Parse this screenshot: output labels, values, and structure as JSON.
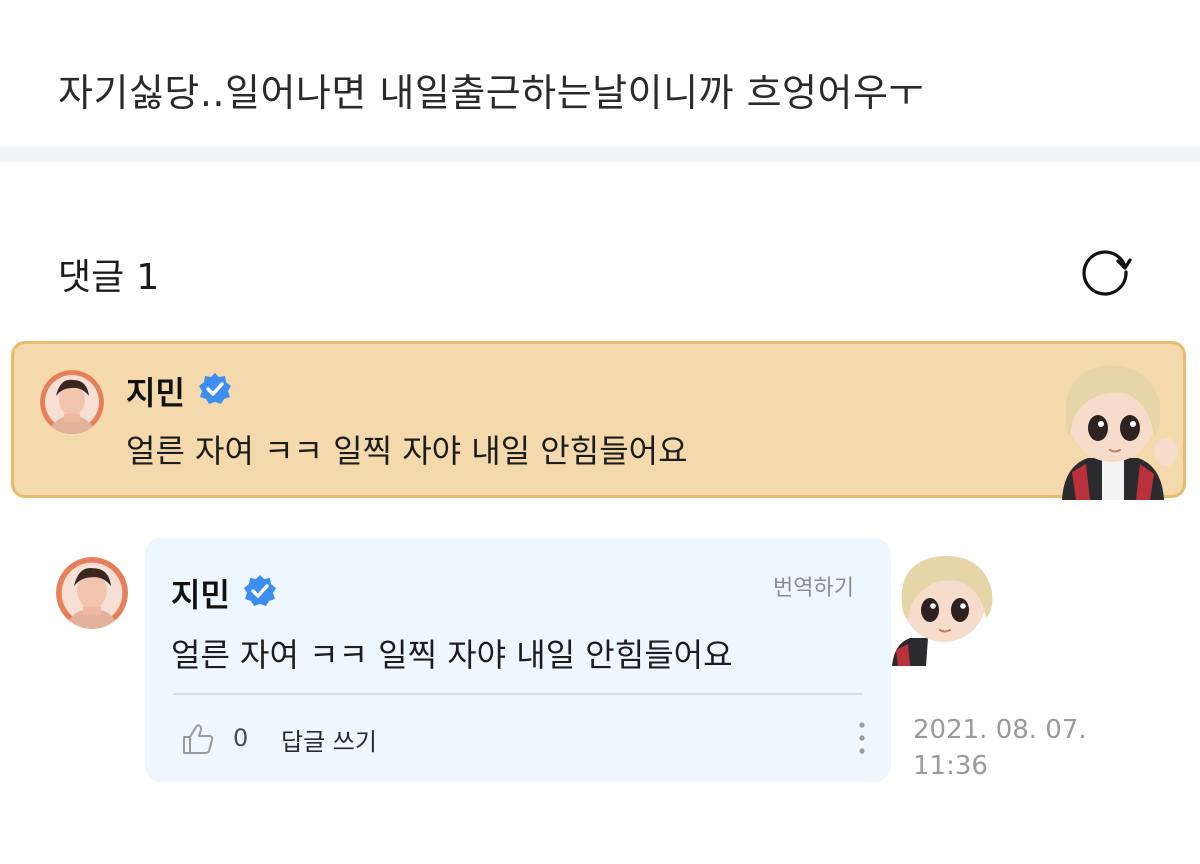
{
  "post": {
    "text": "자기싫당..일어나면 내일출근하는날이니까 흐엉어우ㅜ"
  },
  "comments_header": {
    "label": "댓글",
    "count": "1"
  },
  "icons": {
    "refresh": "refresh-icon",
    "verified": "verified-badge-icon",
    "like": "thumbs-up-icon",
    "more": "more-vertical-icon"
  },
  "colors": {
    "pinned_background": "#f4d9ac",
    "pinned_border": "#e7bd6d",
    "bubble_background": "#eef7fd",
    "verified_blue": "#3d8ef0"
  },
  "pinned_comment": {
    "author": "지민",
    "text": "얼른 자여 ㅋㅋ 일찍 자야 내일 안힘들어요"
  },
  "comment": {
    "author": "지민",
    "translate_label": "번역하기",
    "text": "얼른 자여 ㅋㅋ 일찍 자야 내일 안힘들어요",
    "like_count": "0",
    "reply_label": "답글 쓰기",
    "timestamp_date": "2021. 08. 07.",
    "timestamp_time": "11:36"
  }
}
